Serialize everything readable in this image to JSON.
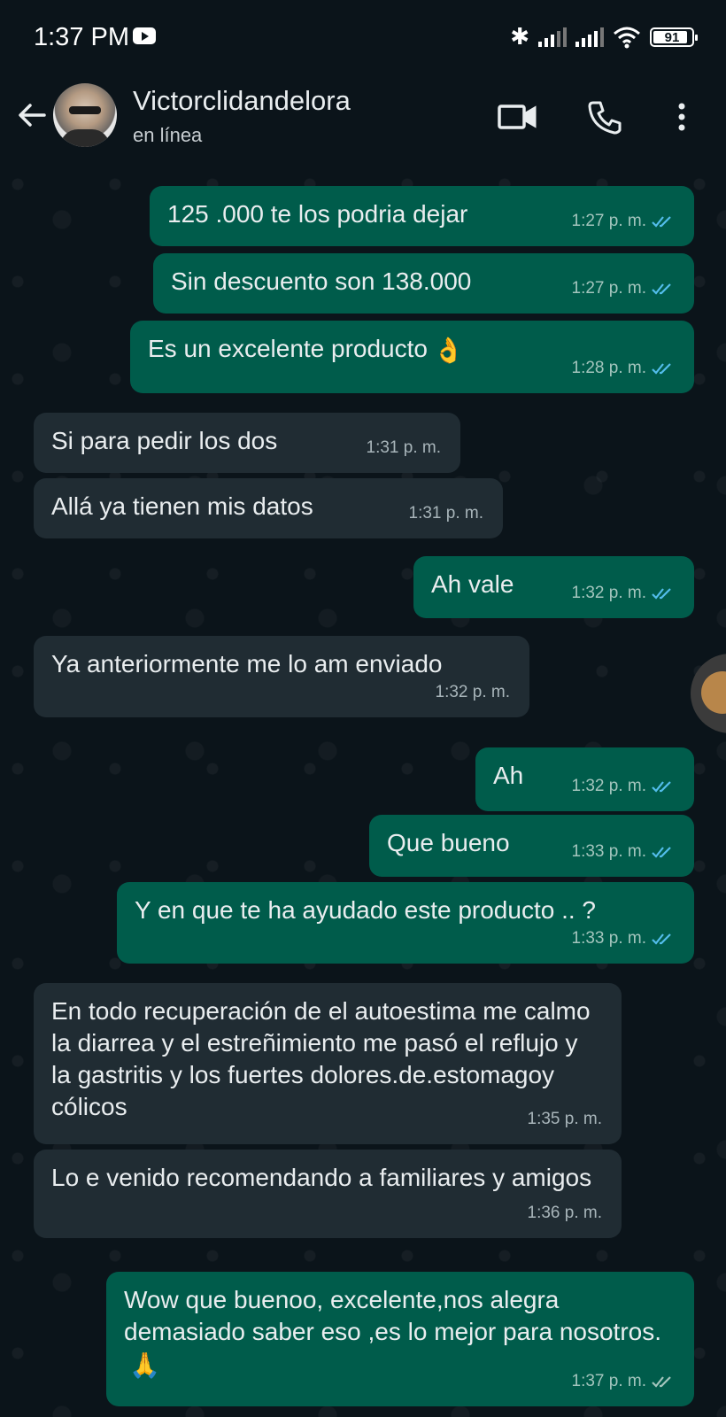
{
  "status_bar": {
    "time": "1:37 PM",
    "battery": "91",
    "icons": [
      "youtube-icon",
      "bluetooth-icon",
      "signal-icon",
      "signal-icon",
      "wifi-icon",
      "battery-icon"
    ]
  },
  "header": {
    "contact_name": "Victorclidandelora",
    "contact_status": "en línea",
    "icons": [
      "back-arrow-icon",
      "video-call-icon",
      "phone-icon",
      "more-vertical-icon"
    ]
  },
  "colors": {
    "background": "#0b141a",
    "outgoing_bubble": "#005c4b",
    "incoming_bubble": "#202c33",
    "read_ticks": "#53bdeb"
  },
  "messages": [
    {
      "direction": "out",
      "text": "125 .000 te los podria dejar",
      "time": "1:27 p. m.",
      "status": "read"
    },
    {
      "direction": "out",
      "text": "Sin descuento son 138.000",
      "time": "1:27 p. m.",
      "status": "read"
    },
    {
      "direction": "out",
      "text": "Es un excelente producto",
      "emoji": "👌",
      "time": "1:28 p. m.",
      "status": "read"
    },
    {
      "direction": "in",
      "text": "Si para pedir los dos",
      "time": "1:31 p. m."
    },
    {
      "direction": "in",
      "text": "Allá ya tienen mis datos",
      "time": "1:31 p. m."
    },
    {
      "direction": "out",
      "text": "Ah vale",
      "time": "1:32 p. m.",
      "status": "read"
    },
    {
      "direction": "in",
      "text": "Ya anteriormente me lo am enviado",
      "time": "1:32 p. m."
    },
    {
      "direction": "out",
      "text": "Ah",
      "time": "1:32 p. m.",
      "status": "read"
    },
    {
      "direction": "out",
      "text": "Que bueno",
      "time": "1:33 p. m.",
      "status": "read"
    },
    {
      "direction": "out",
      "text": "Y en que te ha ayudado este producto .. ?",
      "time": "1:33 p. m.",
      "status": "read"
    },
    {
      "direction": "in",
      "text": "En todo recuperación de el autoestima me calmo la diarrea y el estreñimiento me pasó el reflujo y la gastritis y los fuertes dolores.de.estomagoy cólicos",
      "time": "1:35 p. m."
    },
    {
      "direction": "in",
      "text": "Lo e venido recomendando a familiares y amigos",
      "time": "1:36 p. m."
    },
    {
      "direction": "out",
      "text": "Wow que buenoo, excelente,nos alegra demasiado saber eso  ,es lo mejor para nosotros.",
      "emoji": "🙏",
      "time": "1:37 p. m.",
      "status": "delivered"
    }
  ]
}
